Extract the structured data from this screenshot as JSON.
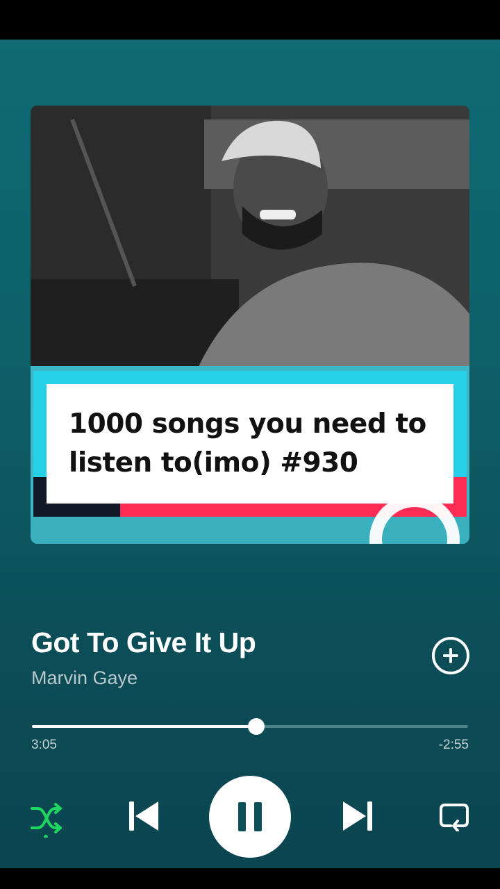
{
  "cover": {
    "overlay_text": "1000 songs you need to\nlisten to(imo) #930"
  },
  "track": {
    "title": "Got To Give It Up",
    "artist": "Marvin Gaye"
  },
  "playback": {
    "elapsed": "3:05",
    "remaining": "-2:55",
    "progress": 0.514,
    "shuffle_active": true,
    "state": "playing"
  },
  "icons": {
    "add": "add-circle-icon",
    "shuffle": "shuffle-icon",
    "previous": "skip-previous-icon",
    "pause": "pause-icon",
    "next": "skip-next-icon",
    "repeat": "repeat-icon"
  },
  "colors": {
    "accent": "#1ed760",
    "background": "#0d5d66",
    "tiktok_red": "#fe2c55",
    "tiktok_cyan": "#25d0e8"
  }
}
